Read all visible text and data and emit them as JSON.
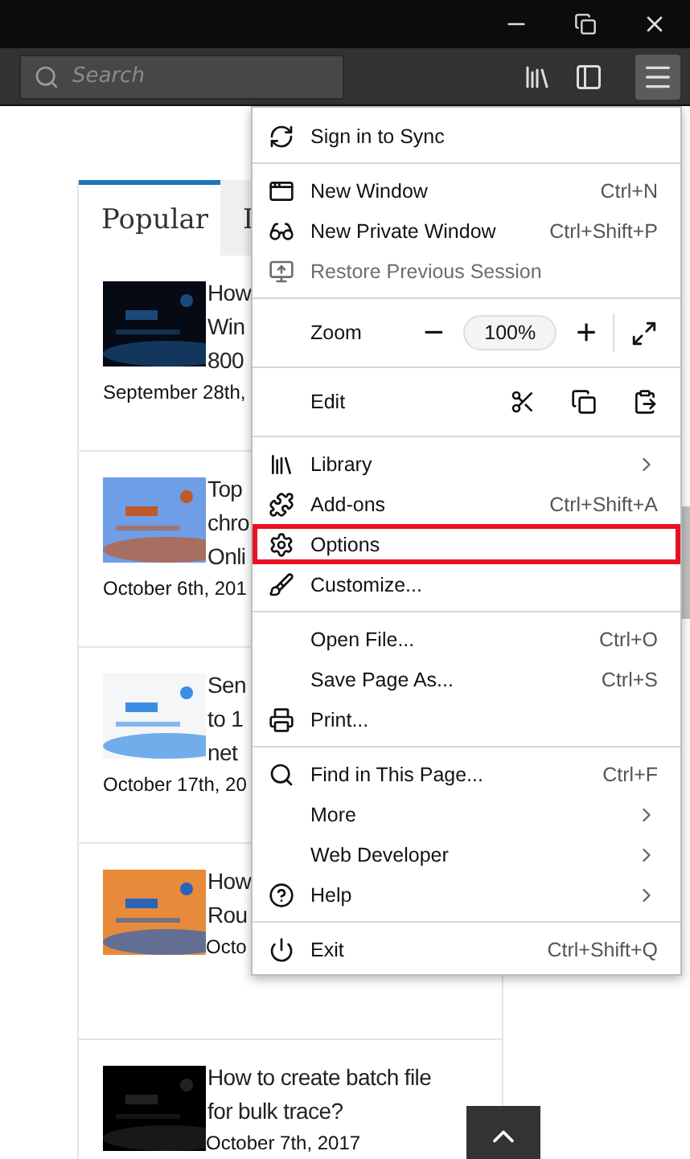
{
  "search": {
    "placeholder": "Search"
  },
  "tabs": [
    {
      "label": "Popular",
      "selected": true
    },
    {
      "label": "I",
      "selected": false
    }
  ],
  "articles": [
    {
      "title_lines": [
        "How",
        "Win",
        "800"
      ],
      "date": "September 28th,"
    },
    {
      "title_lines": [
        "Top",
        "chro",
        "Onli"
      ],
      "date": "October 6th, 201"
    },
    {
      "title_lines": [
        "Sen",
        "to 1",
        "net"
      ],
      "date": "October 17th, 20"
    },
    {
      "title_lines": [
        "How",
        "Rou"
      ],
      "date": "Octo"
    },
    {
      "title_lines": [
        "How to create batch file",
        "for bulk trace?"
      ],
      "date": "October 7th, 2017"
    }
  ],
  "menu": [
    {
      "kind": "item",
      "label": "Sign in to Sync"
    },
    {
      "kind": "separator"
    },
    {
      "kind": "item",
      "label": "New Window",
      "shortcut": "Ctrl+N"
    },
    {
      "kind": "item",
      "label": "New Private Window",
      "shortcut": "Ctrl+Shift+P"
    },
    {
      "kind": "item",
      "label": "Restore Previous Session",
      "disabled": true
    },
    {
      "kind": "separator"
    },
    {
      "kind": "zoom",
      "label": "Zoom",
      "value": "100%",
      "minus": "−",
      "plus": "+"
    },
    {
      "kind": "separator"
    },
    {
      "kind": "edit",
      "label": "Edit"
    },
    {
      "kind": "separator"
    },
    {
      "kind": "item",
      "label": "Library",
      "submenu": true
    },
    {
      "kind": "item",
      "label": "Add-ons",
      "shortcut": "Ctrl+Shift+A"
    },
    {
      "kind": "item",
      "label": "Options",
      "highlighted": true
    },
    {
      "kind": "item",
      "label": "Customize..."
    },
    {
      "kind": "separator"
    },
    {
      "kind": "item",
      "label": "Open File...",
      "shortcut": "Ctrl+O"
    },
    {
      "kind": "item",
      "label": "Save Page As...",
      "shortcut": "Ctrl+S"
    },
    {
      "kind": "item",
      "label": "Print..."
    },
    {
      "kind": "separator"
    },
    {
      "kind": "item",
      "label": "Find in This Page...",
      "shortcut": "Ctrl+F"
    },
    {
      "kind": "item",
      "label": "More",
      "submenu": true
    },
    {
      "kind": "item",
      "label": "Web Developer",
      "submenu": true
    },
    {
      "kind": "item",
      "label": "Help",
      "submenu": true
    },
    {
      "kind": "separator"
    },
    {
      "kind": "item",
      "label": "Exit",
      "shortcut": "Ctrl+Shift+Q"
    }
  ]
}
